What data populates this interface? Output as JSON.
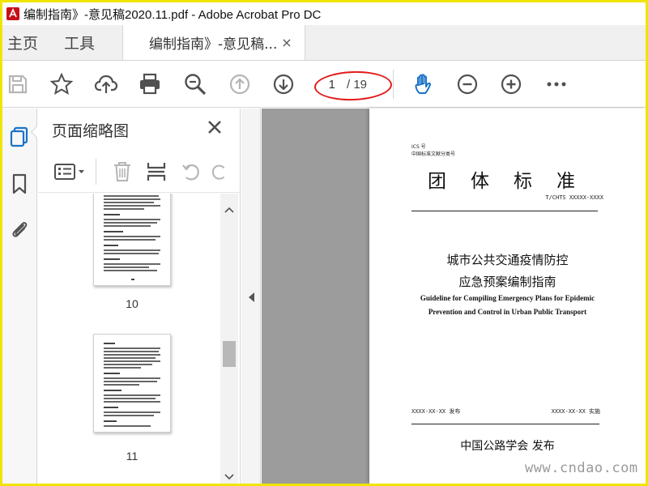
{
  "window": {
    "title": "编制指南》-意见稿2020.11.pdf - Adobe Acrobat Pro DC"
  },
  "tabs": {
    "home": "主页",
    "tools": "工具",
    "document": "编制指南》-意见稿...",
    "close_symbol": "×"
  },
  "toolbar": {
    "current_page": "1",
    "total_pages": "/ 19",
    "icons": [
      "save-icon",
      "bookmark-star-icon",
      "upload-cloud-icon",
      "print-icon",
      "zoom-search-icon",
      "previous-page-icon",
      "next-page-icon",
      "hand-tool-icon",
      "zoom-out-icon",
      "zoom-in-icon",
      "more-icon"
    ]
  },
  "rail": {
    "icons": [
      "page-thumbnails-icon",
      "bookmarks-icon",
      "attachments-icon"
    ]
  },
  "panel": {
    "title": "页面缩略图",
    "thumbnails": [
      {
        "label": "10"
      },
      {
        "label": "11"
      }
    ]
  },
  "document_page": {
    "ics_label": "ICS 号",
    "classification_label": "中国标准文献分类号",
    "heading": "团体标准",
    "code": "T/CHTS XXXXX-XXXX",
    "title_cn_line1": "城市公共交通疫情防控",
    "title_cn_line2": "应急预案编制指南",
    "title_en_line1": "Guideline for Compiling Emergency Plans for Epidemic",
    "title_en_line2": "Prevention and Control in Urban Public Transport",
    "issue_date": "XXXX-XX-XX 发布",
    "effective_date": "XXXX-XX-XX 实施",
    "publisher": "中国公路学会  发布"
  },
  "watermark": "www.cndao.com",
  "colors": {
    "frame_yellow": "#f0e500",
    "annotation_red": "#e21b1b",
    "active_blue": "#1a73c8",
    "icon_gray": "#505050",
    "doc_background": "#9c9c9c"
  }
}
